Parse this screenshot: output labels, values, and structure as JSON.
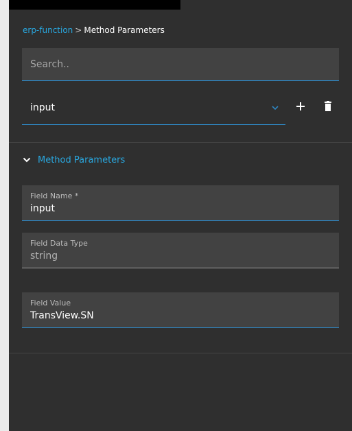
{
  "breadcrumb": {
    "parent": "erp-function",
    "separator": ">",
    "current": "Method Parameters"
  },
  "search": {
    "placeholder": "Search..",
    "value": ""
  },
  "selector": {
    "selected": "input",
    "chevron_icon": "chevron-down-icon",
    "add_icon": "plus-icon",
    "delete_icon": "trash-icon"
  },
  "section": {
    "title": "Method Parameters",
    "expanded": true,
    "fields": [
      {
        "label": "Field Name *",
        "value": "input"
      },
      {
        "label": "Field Data Type",
        "value": "string"
      },
      {
        "label": "Field Value",
        "value": "TransView.SN"
      }
    ]
  },
  "colors": {
    "accent": "#29a8e0",
    "underline": "#2f86c1",
    "panel_bg": "#2f2f2f",
    "field_bg": "#424242"
  }
}
